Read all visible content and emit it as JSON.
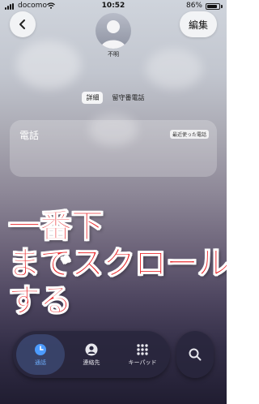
{
  "status_bar": {
    "carrier": "docomo",
    "time": "10:52",
    "battery_percent_label": "86%",
    "battery_level": 0.86
  },
  "header": {
    "edit_label": "編集",
    "contact_name": "不明"
  },
  "segments": {
    "details_label": "詳細",
    "voicemail_label": "留守番電話"
  },
  "phone_section": {
    "title": "電話",
    "tag": "最近使った電話"
  },
  "overlay_caption": {
    "line1": "一番下",
    "line2": "までスクロール",
    "line3": "する"
  },
  "tab_bar": {
    "tabs": [
      {
        "label": "通話",
        "icon": "clock-icon",
        "selected": true
      },
      {
        "label": "連絡先",
        "icon": "person-icon",
        "selected": false
      },
      {
        "label": "キーパッド",
        "icon": "keypad-icon",
        "selected": false
      }
    ],
    "search_icon": "search-icon"
  },
  "colors": {
    "caption_red": "#e8262a",
    "selected_tab_blue": "#6fb0ff"
  }
}
